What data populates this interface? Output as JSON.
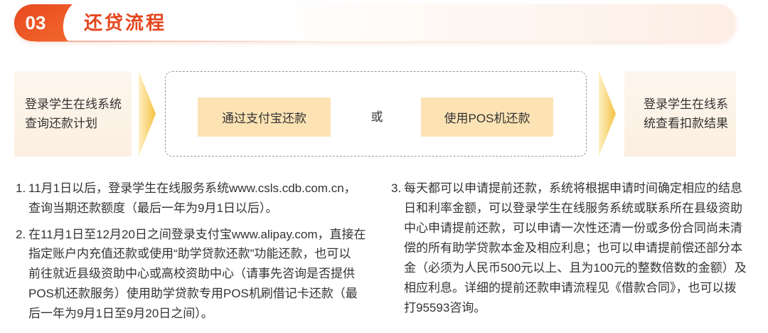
{
  "header": {
    "number": "03",
    "title": "还贷流程"
  },
  "flow": {
    "start_step": {
      "lines": [
        "登录学生在线系统",
        "查询还款计划"
      ]
    },
    "options": [
      {
        "label": "通过支付宝还款"
      },
      {
        "label": "使用POS机还款"
      }
    ],
    "separator": "或",
    "end_step": {
      "lines": [
        "登录学生在线系",
        "统查看扣款结果"
      ]
    }
  },
  "notes": {
    "left": [
      {
        "number": "1.",
        "lines": [
          "11月1日以后，登录学生在线服务系统www.csls.cdb.com.cn，",
          "查询当期还款额度（最后一年为9月1日以后）。"
        ]
      },
      {
        "number": "2.",
        "lines": [
          "在11月1日至12月20日之间登录支付宝www.alipay.com，直接在",
          "指定账户内充值还款或使用“助学贷款还款”功能还款，也可以",
          "前往就近县级资助中心或高校资助中心（请事先咨询是否提供",
          "POS机还款服务）使用助学贷款专用POS机刷借记卡还款（最",
          "后一年为9月1日至9月20日之间）。"
        ]
      }
    ],
    "right": [
      {
        "number": "3.",
        "lines": [
          "每天都可以申请提前还款，系统将根据申请时间确定相应的结息",
          "日和利率金额，可以登录学生在线服务系统或联系所在县级资助",
          "中心申请提前还款，可以申请一次性还清一份或多份合同尚未清",
          "偿的所有助学贷款本金及相应利息；也可以申请提前偿还部分本",
          "金（必须为人民币500元以上、且为100元的整数倍数的金额）及",
          "相应利息。详细的提前还款申请流程见《借款合同》，也可以拨",
          "打95593咨询。"
        ]
      }
    ]
  },
  "icons": {
    "flow_arrow": "chevron-right-icon"
  },
  "colors": {
    "accent": "#e8481f",
    "accent_light": "#f2692d",
    "title": "#e4461f",
    "step_bg": "#fcefe0",
    "option_bg": "#fde3b4",
    "arrow_light": "#fdf0c4",
    "arrow_dark": "#f6c143",
    "text": "#333333",
    "dashed_border": "#9a9a9a"
  }
}
